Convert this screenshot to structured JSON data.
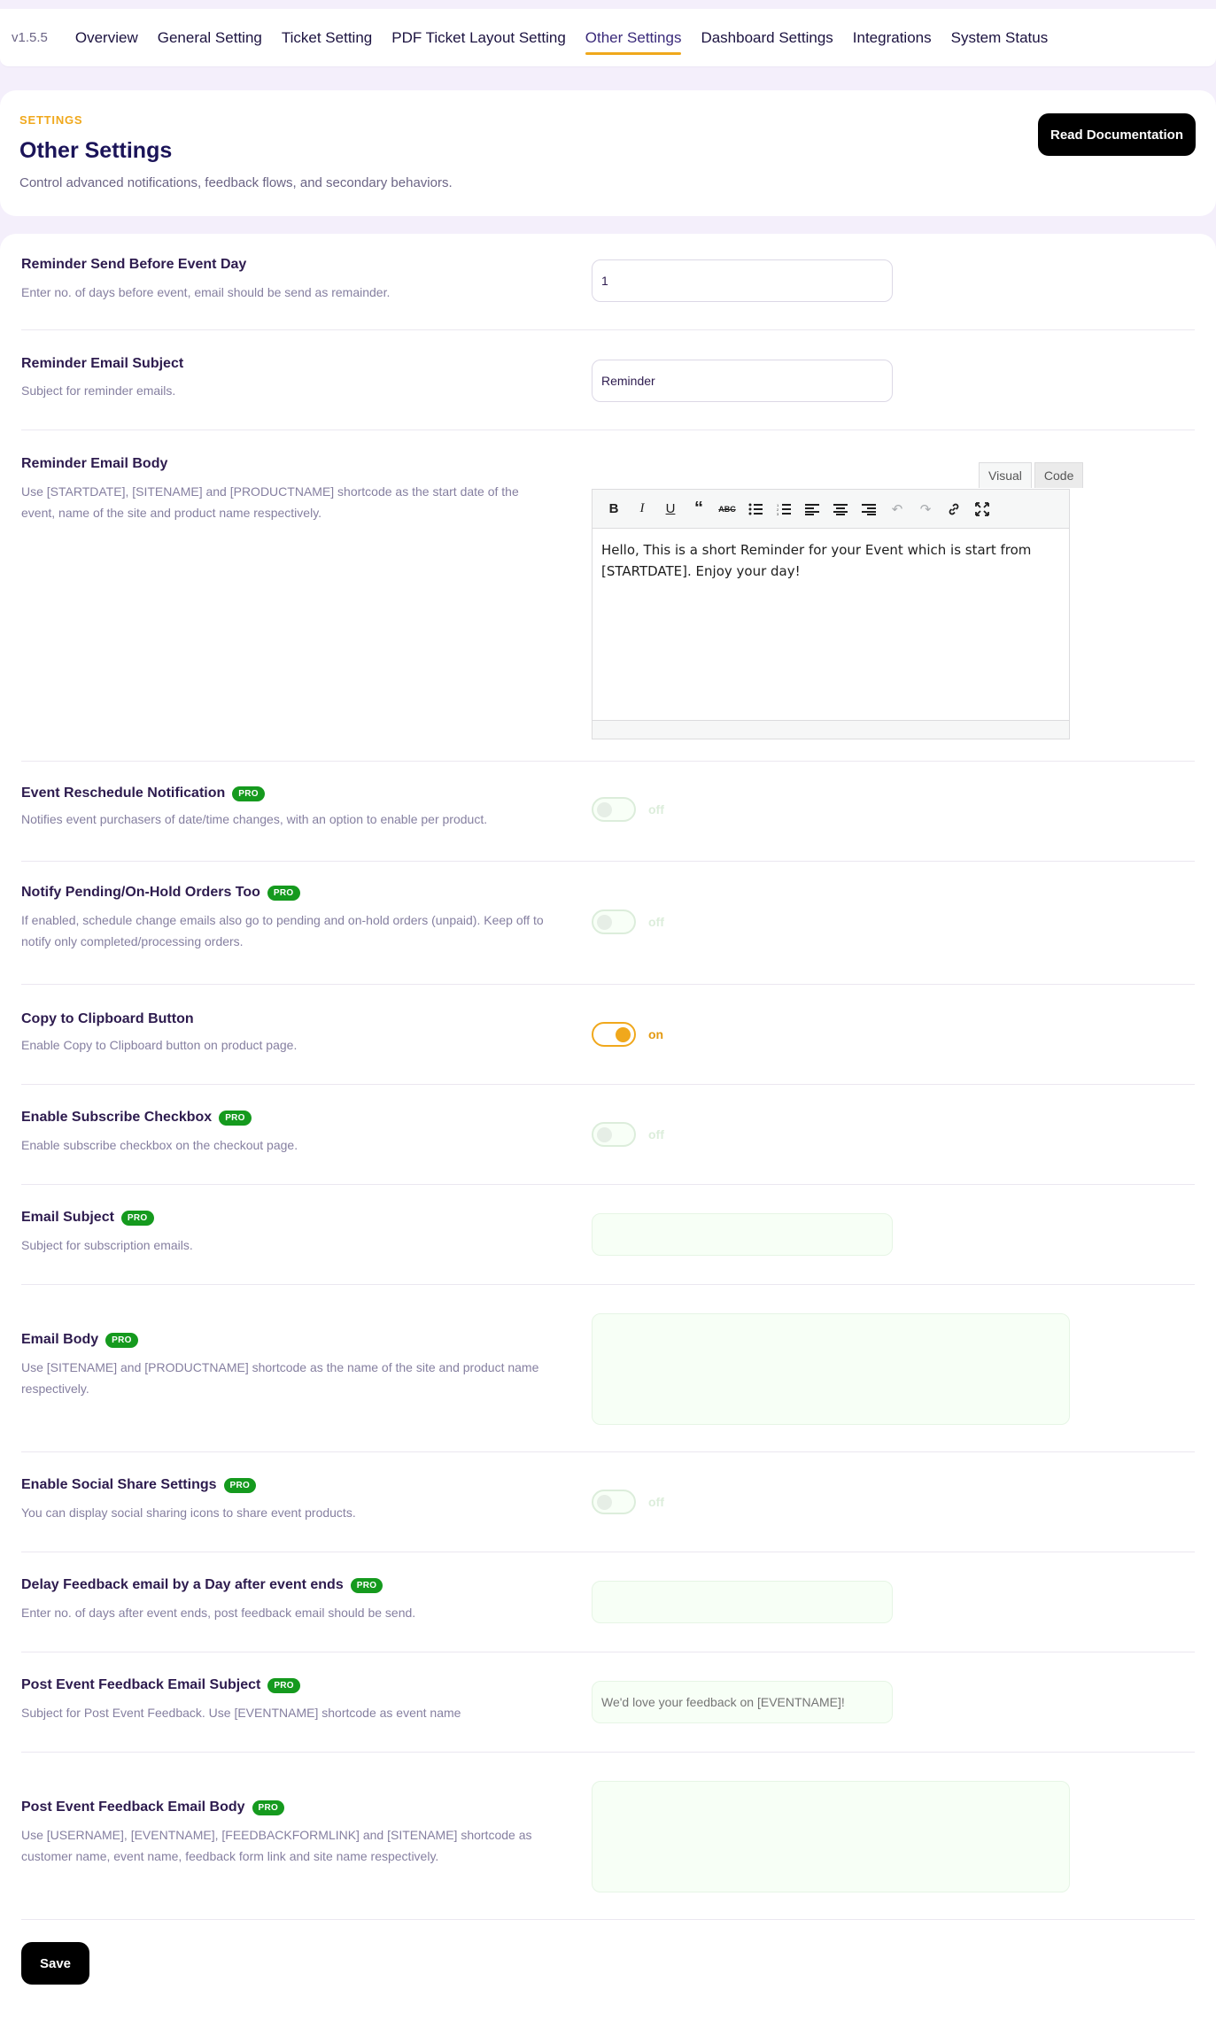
{
  "nav": {
    "version": "v1.5.5",
    "tabs": [
      {
        "label": "Overview"
      },
      {
        "label": "General Setting"
      },
      {
        "label": "Ticket Setting"
      },
      {
        "label": "PDF Ticket Layout Setting"
      },
      {
        "label": "Other Settings"
      },
      {
        "label": "Dashboard Settings"
      },
      {
        "label": "Integrations"
      },
      {
        "label": "System Status"
      }
    ],
    "active_tab": "Other Settings"
  },
  "header": {
    "eyebrow": "SETTINGS",
    "title": "Other Settings",
    "subtitle": "Control advanced notifications, feedback flows, and secondary behaviors.",
    "doc_button": "Read Documentation"
  },
  "pro_badge": "PRO",
  "colors": {
    "accent": "#f0a81c",
    "pro": "#159a1e",
    "title": "#1b1459"
  },
  "settings": {
    "reminder_days": {
      "label": "Reminder Send Before Event Day",
      "desc": "Enter no. of days before event, email should be send as remainder.",
      "value": "1"
    },
    "reminder_subject": {
      "label": "Reminder Email Subject",
      "desc": "Subject for reminder emails.",
      "value": "Reminder"
    },
    "reminder_body": {
      "label": "Reminder Email Body",
      "desc": "Use [STARTDATE], [SITENAME] and [PRODUCTNAME] shortcode as the start date of the event, name of the site and product name respectively.",
      "tab_visual": "Visual",
      "tab_code": "Code",
      "content": "Hello, This is a short Reminder for your Event which is start from [STARTDATE]. Enjoy your day!"
    },
    "reschedule": {
      "label": "Event Reschedule Notification",
      "desc": "Notifies event purchasers of date/time changes, with an option to enable per product.",
      "state": "off"
    },
    "pending_orders": {
      "label": "Notify Pending/On-Hold Orders Too",
      "desc": "If enabled, schedule change emails also go to pending and on-hold orders (unpaid). Keep off to notify only completed/processing orders.",
      "state": "off"
    },
    "clipboard": {
      "label": "Copy to Clipboard Button",
      "desc": "Enable Copy to Clipboard button on product page.",
      "state": "on"
    },
    "subscribe": {
      "label": "Enable Subscribe Checkbox",
      "desc": "Enable subscribe checkbox on the checkout page.",
      "state": "off"
    },
    "email_subject": {
      "label": "Email Subject",
      "desc": "Subject for subscription emails.",
      "value": ""
    },
    "email_body": {
      "label": "Email Body",
      "desc": "Use [SITENAME] and [PRODUCTNAME] shortcode as the name of the site and product name respectively.",
      "value": ""
    },
    "social_share": {
      "label": "Enable Social Share Settings",
      "desc": "You can display social sharing icons to share event products.",
      "state": "off"
    },
    "feedback_delay": {
      "label": "Delay Feedback email by a Day after event ends",
      "desc": "Enter no. of days after event ends, post feedback email should be send.",
      "value": ""
    },
    "feedback_subject": {
      "label": "Post Event Feedback Email Subject",
      "desc": "Subject for Post Event Feedback. Use [EVENTNAME] shortcode as event name",
      "placeholder": "We'd love your feedback on [EVENTNAME]!"
    },
    "feedback_body": {
      "label": "Post Event Feedback Email Body",
      "desc": "Use [USERNAME], [EVENTNAME], [FEEDBACKFORMLINK] and [SITENAME] shortcode as customer name, event name, feedback form link and site name respectively.",
      "value": ""
    }
  },
  "save_button": "Save"
}
